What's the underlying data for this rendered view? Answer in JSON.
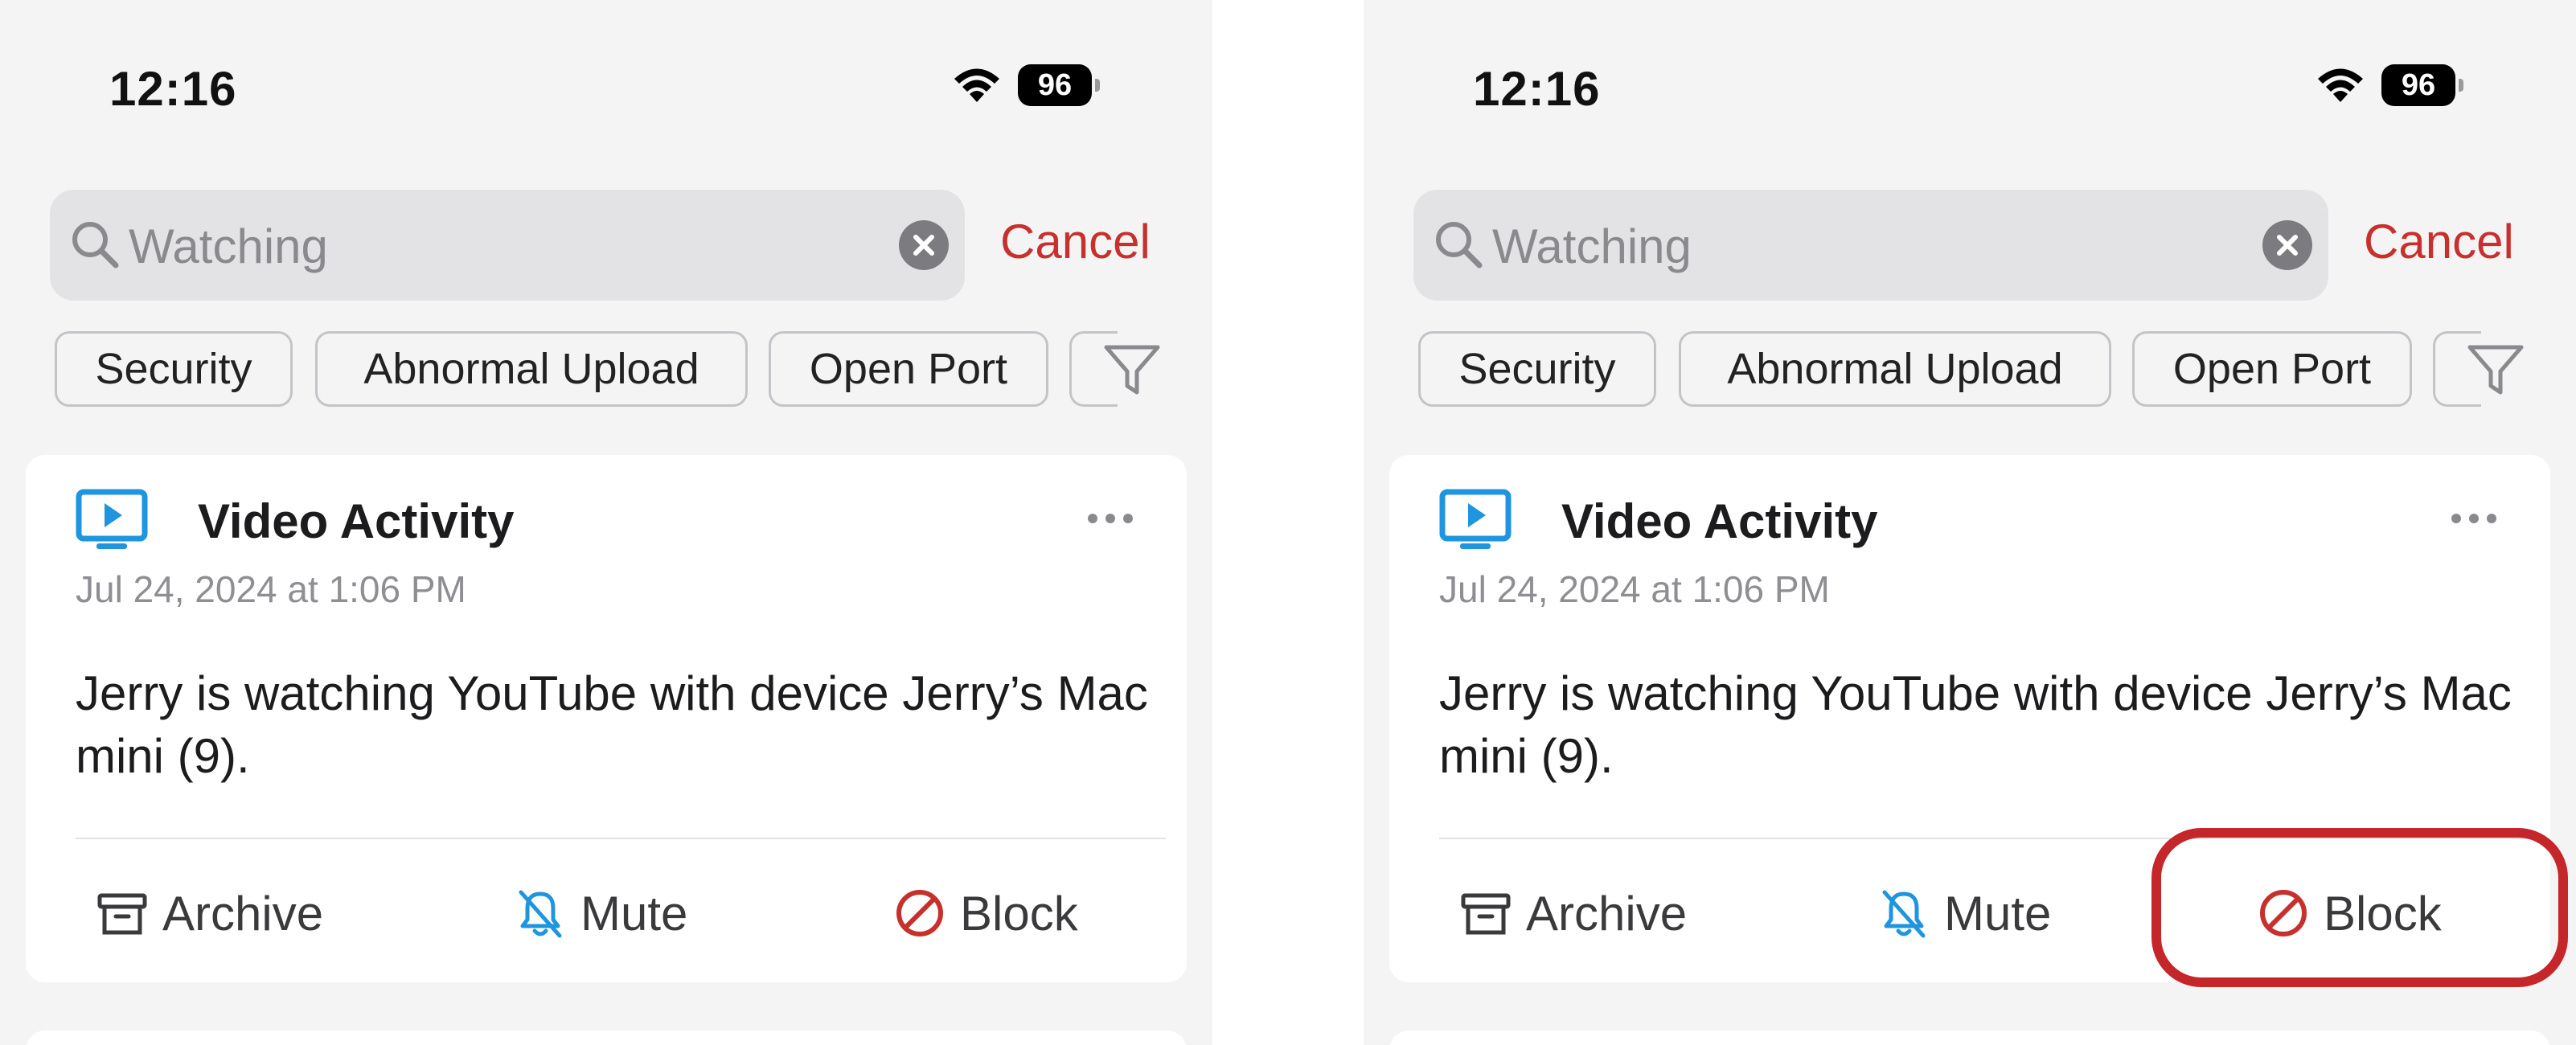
{
  "status": {
    "time": "12:16",
    "battery": "96"
  },
  "search": {
    "query": "Watching",
    "cancel_label": "Cancel"
  },
  "filters": {
    "chips": [
      "Security",
      "Abnormal Upload",
      "Open Port"
    ]
  },
  "card": {
    "title": "Video Activity",
    "date": "Jul 24, 2024 at 1:06 PM",
    "message": "Jerry is watching YouTube with device Jerry’s Mac mini (9).",
    "actions": {
      "archive": "Archive",
      "mute": "Mute",
      "block": "Block"
    }
  },
  "colors": {
    "accent_red": "#c7302c",
    "icon_blue": "#1f95e0",
    "highlight": "#c4262a"
  }
}
